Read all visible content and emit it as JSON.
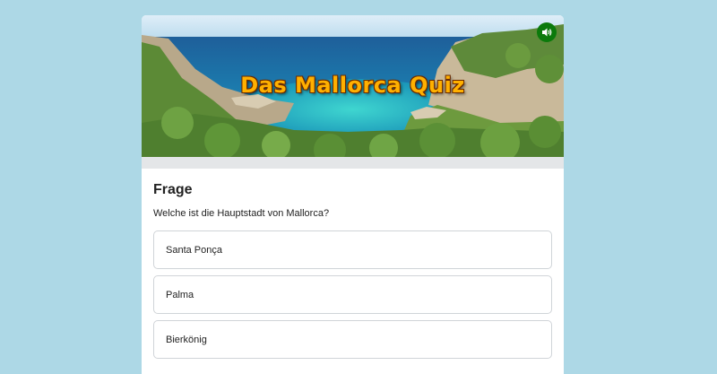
{
  "banner": {
    "title": "Das Mallorca Quiz",
    "sound_icon": "speaker-icon"
  },
  "question": {
    "heading": "Frage",
    "text": "Welche ist die Hauptstadt von Mallorca?"
  },
  "answers": [
    {
      "label": "Santa Ponça"
    },
    {
      "label": "Palma"
    },
    {
      "label": "Bierkönig"
    }
  ],
  "colors": {
    "page_background": "#add8e6",
    "sound_button": "#0b7a0b",
    "title_fill": "#ffb000"
  }
}
